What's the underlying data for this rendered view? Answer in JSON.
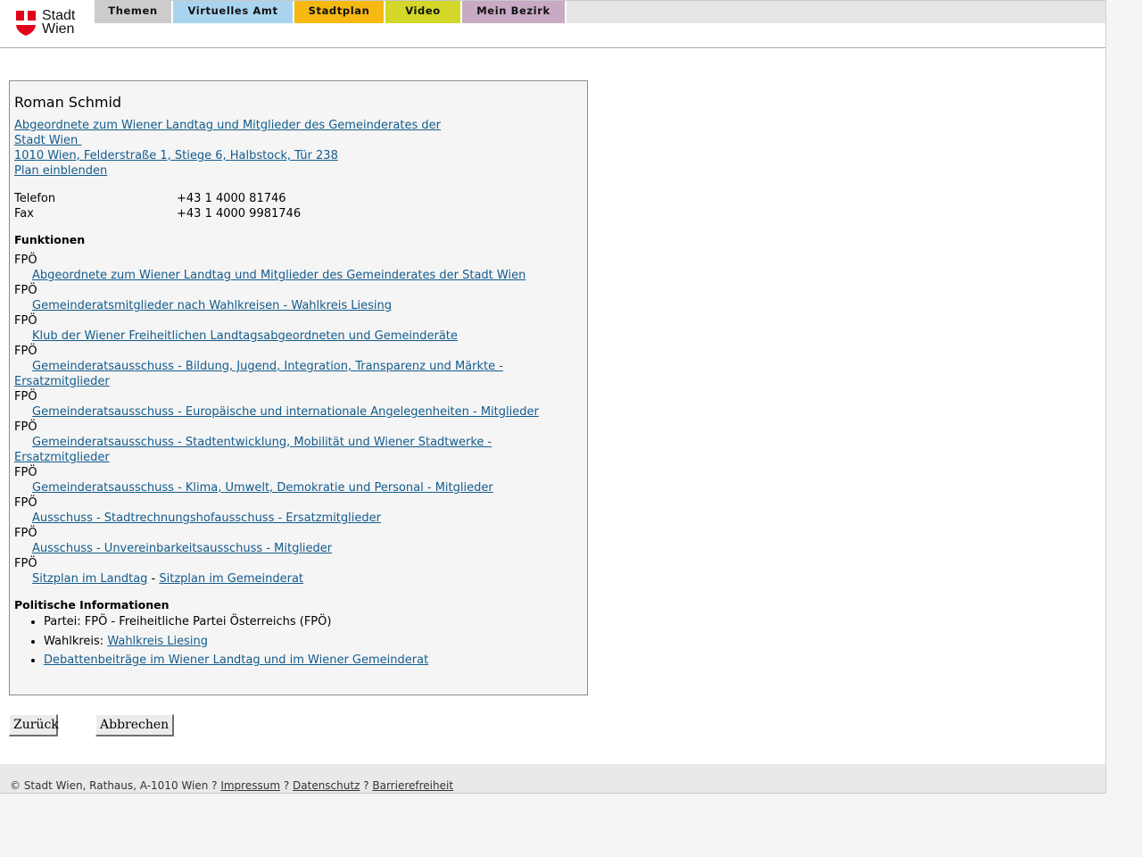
{
  "header": {
    "logo": {
      "line1": "Stadt",
      "line2": "Wien",
      "accent": "#e2001a"
    },
    "tabs": [
      {
        "label": "Themen",
        "color": "#cccccc"
      },
      {
        "label": "Virtuelles Amt",
        "color": "#a9d4f0"
      },
      {
        "label": "Stadtplan",
        "color": "#f6b912"
      },
      {
        "label": "Video",
        "color": "#d3d727"
      },
      {
        "label": "Mein Bezirk",
        "color": "#c8aac4"
      }
    ]
  },
  "person": {
    "name": "Roman Schmid",
    "org_line1": "Abgeordnete zum Wiener Landtag und Mitglieder des Gemeinderates der",
    "org_line2": "Stadt Wien ",
    "address": "1010 Wien, Felderstraße 1, Stiege 6, Halbstock, Tür 238",
    "plan_link": "Plan einblenden",
    "phone_label": "Telefon",
    "phone": "+43 1 4000 81746",
    "fax_label": "Fax",
    "fax": "+43 1 4000 9981746"
  },
  "functions": {
    "title": "Funktionen",
    "items": [
      {
        "party": "FPÖ",
        "link": "Abgeordnete zum Wiener Landtag und Mitglieder des Gemeinderates der Stadt Wien"
      },
      {
        "party": "FPÖ",
        "link": "Gemeinderatsmitglieder nach Wahlkreisen - Wahlkreis Liesing"
      },
      {
        "party": "FPÖ",
        "link": "Klub der Wiener Freiheitlichen Landtagsabgeordneten und Gemeinderäte"
      },
      {
        "party": "FPÖ",
        "link": "Gemeinderatsausschuss - Bildung, Jugend, Integration, Transparenz und Märkte - Ersatzmitglieder"
      },
      {
        "party": "FPÖ",
        "link": "Gemeinderatsausschuss - Europäische und internationale Angelegenheiten - Mitglieder"
      },
      {
        "party": "FPÖ",
        "link": "Gemeinderatsausschuss - Stadtentwicklung, Mobilität und Wiener Stadtwerke - Ersatzmitglieder"
      },
      {
        "party": "FPÖ",
        "link": "Gemeinderatsausschuss - Klima, Umwelt, Demokratie und Personal - Mitglieder"
      },
      {
        "party": "FPÖ",
        "link": "Ausschuss - Stadtrechnungshofausschuss - Ersatzmitglieder"
      },
      {
        "party": "FPÖ",
        "link": "Ausschuss - Unvereinbarkeitsausschuss - Mitglieder"
      }
    ],
    "seat_party": "FPÖ",
    "seat_landtag": "Sitzplan im Landtag",
    "seat_sep": " - ",
    "seat_gemeinderat": "Sitzplan im Gemeinderat"
  },
  "political": {
    "title": "Politische Informationen",
    "party": "Partei: FPÖ - Freiheitliche Partei Österreichs (FPÖ)",
    "wahlkreis_label": "Wahlkreis: ",
    "wahlkreis_link": "Wahlkreis Liesing",
    "debates_link": "Debattenbeiträge im Wiener Landtag und im Wiener Gemeinderat"
  },
  "buttons": {
    "back": "Zurück",
    "cancel": "Abbrechen"
  },
  "footer": {
    "copyright": "© Stadt Wien, Rathaus, A-1010 Wien ? ",
    "impressum": "Impressum",
    "sep1": " ? ",
    "datenschutz": "Datenschutz",
    "sep2": " ? ",
    "barrierefreiheit": "Barrierefreiheit"
  }
}
